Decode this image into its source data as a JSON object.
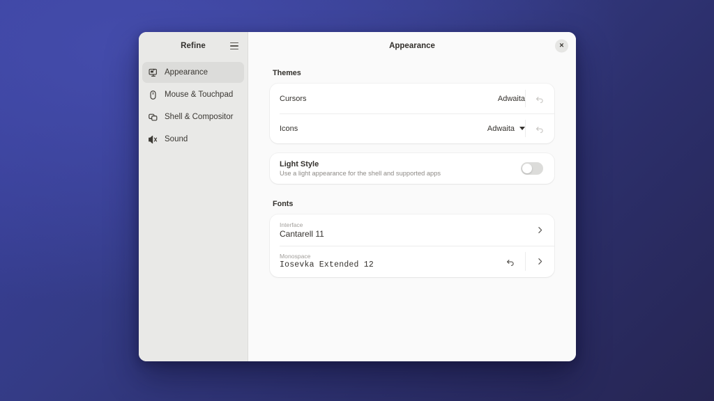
{
  "app": {
    "sidebar_title": "Refine",
    "window_title": "Appearance",
    "close_label": "×",
    "menu_icon": "hamburger-icon"
  },
  "sidebar": {
    "items": [
      {
        "label": "Appearance",
        "icon": "display-appearance-icon",
        "selected": true
      },
      {
        "label": "Mouse & Touchpad",
        "icon": "mouse-icon",
        "selected": false
      },
      {
        "label": "Shell & Compositor",
        "icon": "windows-stack-icon",
        "selected": false
      },
      {
        "label": "Sound",
        "icon": "speaker-icon",
        "selected": false
      }
    ]
  },
  "themes": {
    "group_title": "Themes",
    "rows": [
      {
        "label": "Cursors",
        "value": "Adwaita",
        "has_caret": false,
        "reset_icon": "undo-arrow-icon"
      },
      {
        "label": "Icons",
        "value": "Adwaita",
        "has_caret": true,
        "reset_icon": "undo-arrow-icon"
      }
    ]
  },
  "light_style": {
    "title": "Light Style",
    "subtitle": "Use a light appearance for the shell and supported apps",
    "enabled": false
  },
  "fonts": {
    "group_title": "Fonts",
    "rows": [
      {
        "caption": "Interface",
        "value": "Cantarell 11",
        "has_reset": false,
        "chevron_icon": "chevron-right-icon"
      },
      {
        "caption": "Monospace",
        "value": "Iosevka Extended  12",
        "has_reset": true,
        "reset_icon": "undo-arrow-icon",
        "chevron_icon": "chevron-right-icon"
      }
    ]
  },
  "colors": {
    "background_from": "#3a41a0",
    "background_to": "#262552",
    "sidebar": "#e9e9e7",
    "content": "#fafafa",
    "card": "#ffffff",
    "selected_item": "#dcdcda"
  }
}
